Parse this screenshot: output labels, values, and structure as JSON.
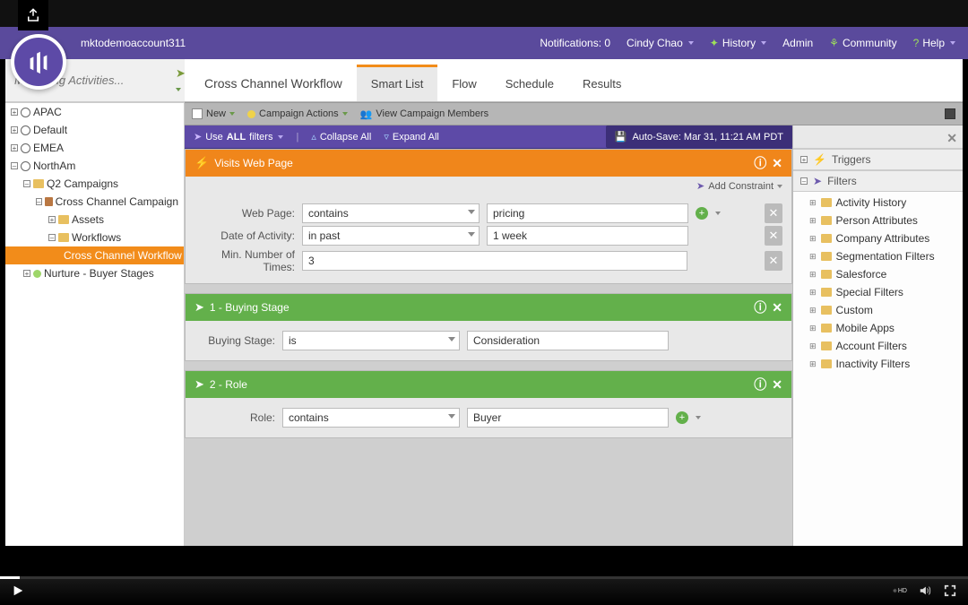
{
  "header": {
    "account": "mktodemoaccount311",
    "notifications": "Notifications: 0",
    "user": "Cindy Chao",
    "history": "History",
    "admin": "Admin",
    "community": "Community",
    "help": "Help"
  },
  "search": {
    "placeholder": "Marketing Activities..."
  },
  "tree": {
    "n0": "APAC",
    "n1": "Default",
    "n2": "EMEA",
    "n3": "NorthAm",
    "n4": "Q2 Campaigns",
    "n5": "Cross Channel Campaign",
    "n6": "Assets",
    "n7": "Workflows",
    "n8": "Cross Channel Workflow",
    "n9": "Nurture - Buyer Stages"
  },
  "tabs": {
    "title": "Cross Channel Workflow",
    "t1": "Smart List",
    "t2": "Flow",
    "t3": "Schedule",
    "t4": "Results"
  },
  "toolbar": {
    "new": "New",
    "actions": "Campaign Actions",
    "view": "View Campaign Members"
  },
  "filterbar": {
    "usefilters_pre": "Use",
    "usefilters_mid": "ALL",
    "usefilters_post": "filters",
    "collapse": "Collapse All",
    "expand": "Expand All",
    "autosave": "Auto-Save: Mar 31, 11:21 AM PDT"
  },
  "cards": {
    "c1": {
      "title": "Visits Web Page",
      "addConstraint": "Add Constraint",
      "rows": {
        "webpage_label": "Web Page:",
        "webpage_op": "contains",
        "webpage_val": "pricing",
        "date_label": "Date of Activity:",
        "date_op": "in past",
        "date_val": "1 week",
        "min_label": "Min. Number of Times:",
        "min_val": "3"
      }
    },
    "c2": {
      "title": "1 - Buying Stage",
      "rows": {
        "label": "Buying Stage:",
        "op": "is",
        "val": "Consideration"
      }
    },
    "c3": {
      "title": "2 - Role",
      "rows": {
        "label": "Role:",
        "op": "contains",
        "val": "Buyer"
      }
    }
  },
  "rightPanel": {
    "triggers": "Triggers",
    "filters": "Filters",
    "items": {
      "i0": "Activity History",
      "i1": "Person Attributes",
      "i2": "Company Attributes",
      "i3": "Segmentation Filters",
      "i4": "Salesforce",
      "i5": "Special Filters",
      "i6": "Custom",
      "i7": "Mobile Apps",
      "i8": "Account Filters",
      "i9": "Inactivity Filters"
    }
  },
  "video": {
    "hd": "HD"
  }
}
